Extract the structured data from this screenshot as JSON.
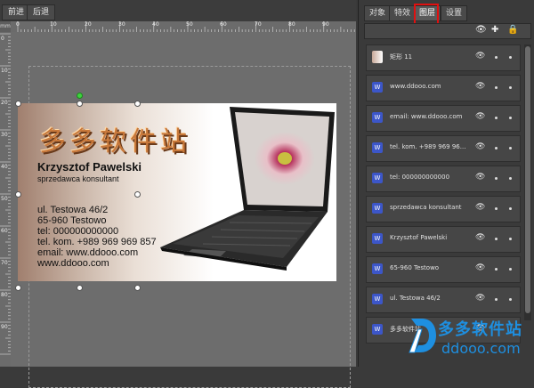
{
  "toolbar": {
    "back_label": "前进",
    "forward_label": "后退"
  },
  "ruler": {
    "unit": "mm",
    "h_ticks": [
      "0",
      "10",
      "20",
      "30",
      "40",
      "50",
      "60",
      "70",
      "80",
      "90"
    ],
    "v_ticks": [
      "0",
      "10",
      "20",
      "30",
      "40",
      "50",
      "60",
      "70",
      "80",
      "90"
    ]
  },
  "card": {
    "brand": "多多软件站",
    "name": "Krzysztof Pawelski",
    "role": "sprzedawca konsultant",
    "address": "ul. Testowa 46/2",
    "city": "65-960 Testowo",
    "tel": "tel: 000000000000",
    "tel_kom": "tel. kom. +989 969 969 857",
    "email": "email: www.ddooo.com",
    "www": "www.ddooo.com"
  },
  "panel": {
    "tabs": [
      {
        "label": "对象"
      },
      {
        "label": "特效"
      },
      {
        "label": "图层",
        "active": true
      },
      {
        "label": "设置"
      }
    ],
    "layers": [
      {
        "name": "矩形 11",
        "type": "rect"
      },
      {
        "name": "www.ddooo.com",
        "type": "text"
      },
      {
        "name": "email: www.ddooo.com",
        "type": "text"
      },
      {
        "name": "tel. kom. +989 969 96...",
        "type": "text"
      },
      {
        "name": "tel: 000000000000",
        "type": "text"
      },
      {
        "name": "sprzedawca konsultant",
        "type": "text"
      },
      {
        "name": "Krzysztof Pawelski",
        "type": "text"
      },
      {
        "name": "65-960 Testowo",
        "type": "text"
      },
      {
        "name": "ul. Testowa 46/2",
        "type": "text"
      },
      {
        "name": "多多软件站",
        "type": "text"
      }
    ]
  },
  "watermark": {
    "title": "多多软件站",
    "url": "ddooo.com"
  },
  "colors": {
    "highlight": "#e01010",
    "brand_orange": "#c8783a",
    "watermark_blue": "#1e8fe0"
  }
}
